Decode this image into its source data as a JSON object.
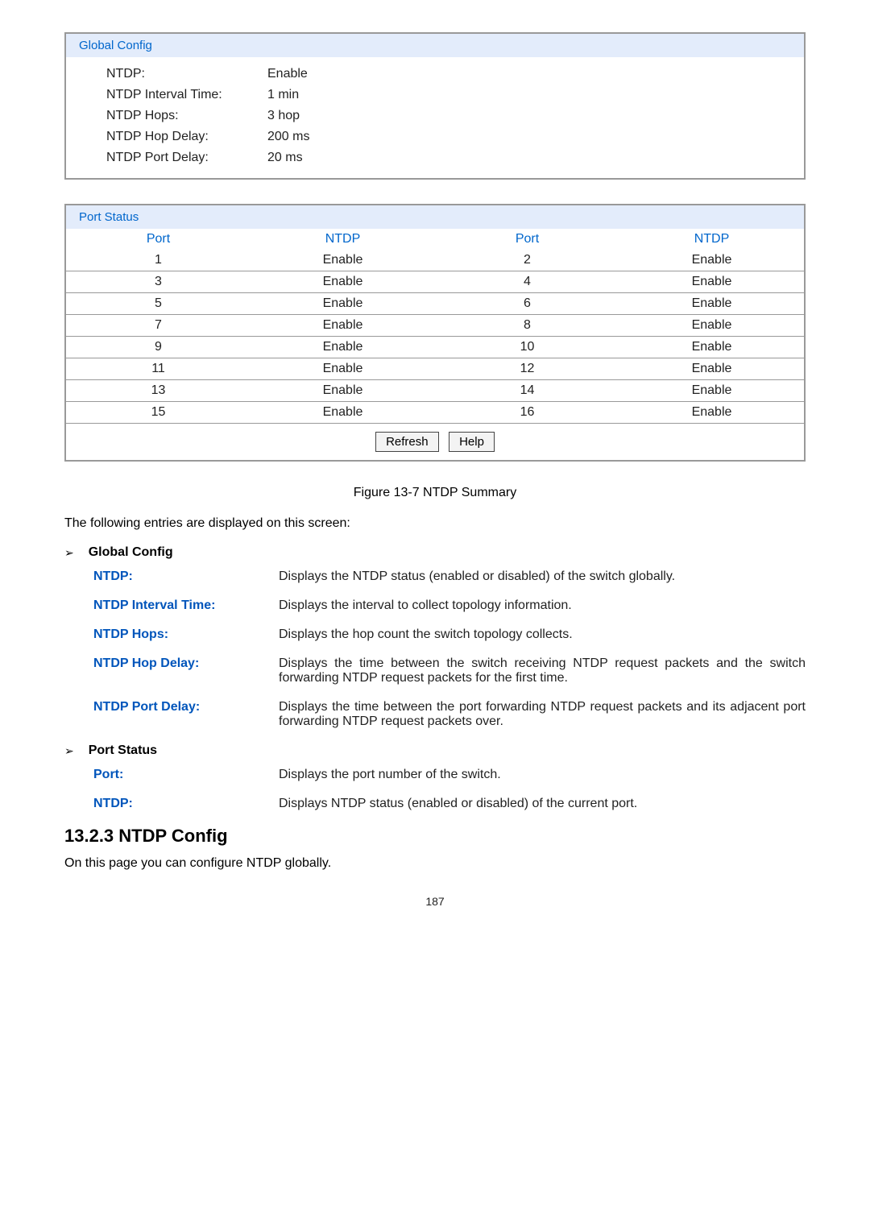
{
  "globalConfig": {
    "header": "Global Config",
    "rows": [
      {
        "label": "NTDP:",
        "value": "Enable"
      },
      {
        "label": "NTDP Interval Time:",
        "value": "1 min"
      },
      {
        "label": "NTDP Hops:",
        "value": "3 hop"
      },
      {
        "label": "NTDP Hop Delay:",
        "value": "200 ms"
      },
      {
        "label": "NTDP Port Delay:",
        "value": "20 ms"
      }
    ]
  },
  "portStatus": {
    "header": "Port Status",
    "colHeaders": [
      "Port",
      "NTDP",
      "Port",
      "NTDP"
    ],
    "rows": [
      [
        "1",
        "Enable",
        "2",
        "Enable"
      ],
      [
        "3",
        "Enable",
        "4",
        "Enable"
      ],
      [
        "5",
        "Enable",
        "6",
        "Enable"
      ],
      [
        "7",
        "Enable",
        "8",
        "Enable"
      ],
      [
        "9",
        "Enable",
        "10",
        "Enable"
      ],
      [
        "11",
        "Enable",
        "12",
        "Enable"
      ],
      [
        "13",
        "Enable",
        "14",
        "Enable"
      ],
      [
        "15",
        "Enable",
        "16",
        "Enable"
      ]
    ],
    "buttons": {
      "refresh": "Refresh",
      "help": "Help"
    }
  },
  "figureCaption": "Figure 13-7 NTDP Summary",
  "introText": "The following entries are displayed on this screen:",
  "sections": {
    "globalConfigTitle": "Global Config",
    "portStatusTitle": "Port Status"
  },
  "definitions": {
    "ntdp": {
      "term": "NTDP:",
      "desc": "Displays the NTDP status (enabled or disabled) of the switch globally."
    },
    "ntdpIntervalTime": {
      "term": "NTDP Interval Time:",
      "desc": "Displays the interval to collect topology information."
    },
    "ntdpHops": {
      "term": "NTDP Hops:",
      "desc": "Displays the hop count the switch topology collects."
    },
    "ntdpHopDelay": {
      "term": "NTDP Hop Delay:",
      "desc": "Displays the time between the switch receiving NTDP request packets and the switch forwarding NTDP request packets for the first time."
    },
    "ntdpPortDelay": {
      "term": "NTDP Port Delay:",
      "desc": "Displays the time between the port forwarding NTDP request packets and its adjacent port forwarding NTDP request packets over."
    },
    "port": {
      "term": "Port:",
      "desc": "Displays the port number of the switch."
    },
    "ntdp2": {
      "term": "NTDP:",
      "desc": "Displays NTDP status (enabled or disabled) of the current port."
    }
  },
  "heading": "13.2.3  NTDP Config",
  "bodyText": "On this page you can configure NTDP globally.",
  "pageNum": "187"
}
